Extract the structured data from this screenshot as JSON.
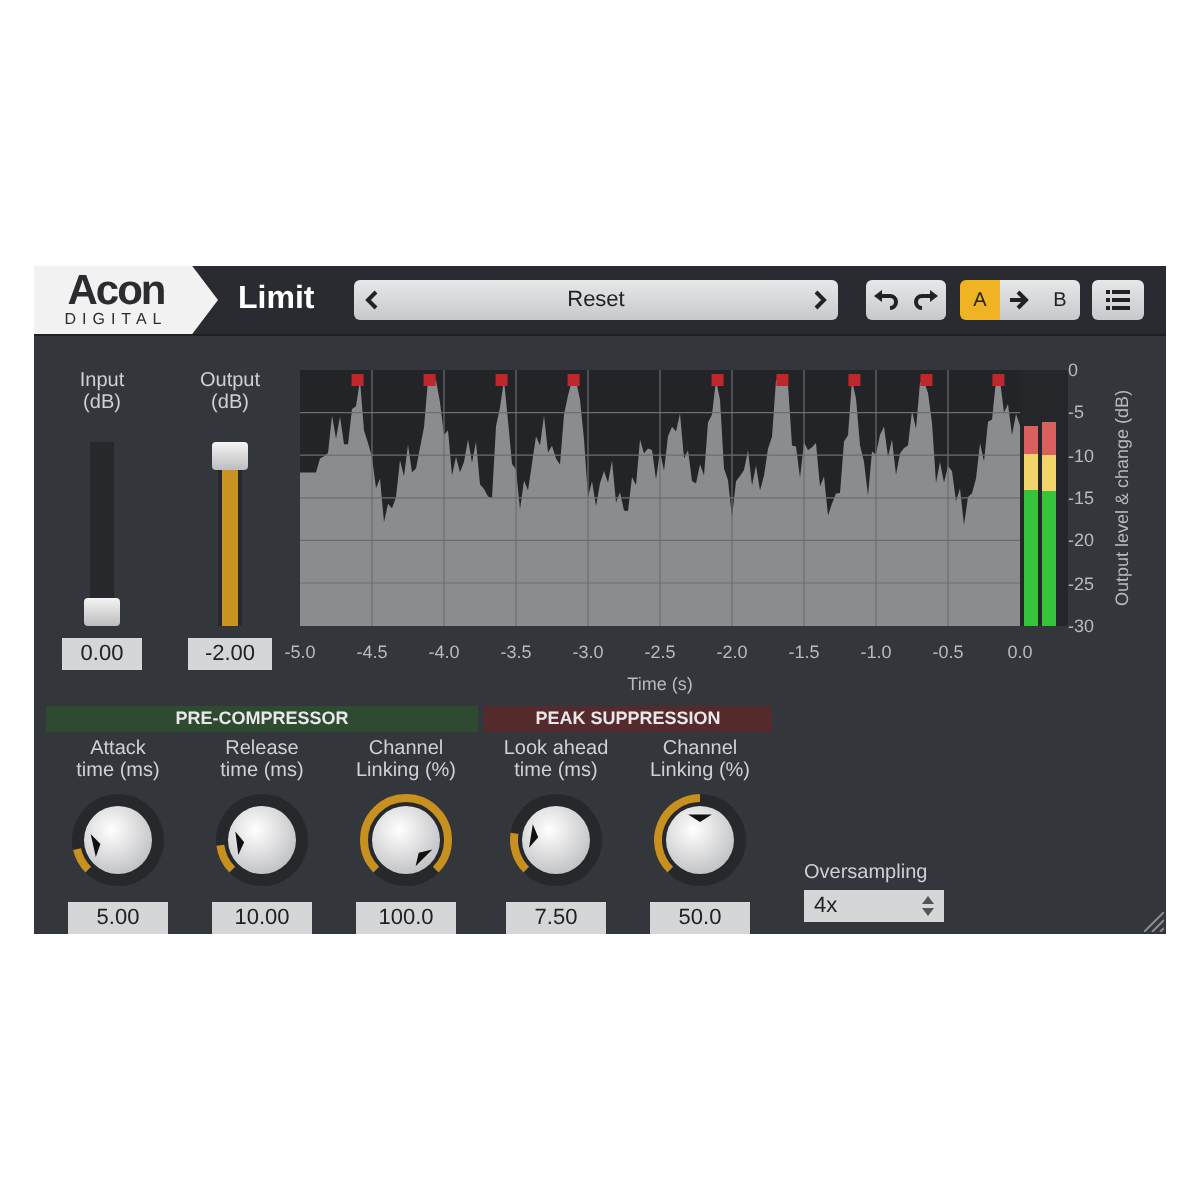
{
  "header": {
    "logo": {
      "wordmark": "Acon",
      "subtitle": "DIGITAL"
    },
    "title": "Limit",
    "preset": "Reset",
    "ab": [
      {
        "label": "A",
        "selected": true
      },
      {
        "label": "B",
        "selected": false
      }
    ]
  },
  "faders": [
    {
      "label": "Input\n(dB)",
      "level": 0.0,
      "value": "0.00"
    },
    {
      "label": "Output\n(dB)",
      "level": 0.92,
      "value": "-2.00"
    }
  ],
  "display": {
    "x_ticks": [
      "-5.0",
      "-4.5",
      "-4.0",
      "-3.5",
      "-3.0",
      "-2.5",
      "-2.0",
      "-1.5",
      "-1.0",
      "-0.5",
      "0.0"
    ],
    "x_title": "Time (s)",
    "y_ticks": [
      "0",
      "-5",
      "-10",
      "-15",
      "-20",
      "-25",
      "-30"
    ],
    "y_title": "Output level & change (dB)",
    "meters": [
      {
        "level": 0.78
      },
      {
        "level": 0.8
      }
    ]
  },
  "sections": [
    {
      "title": "PRE-COMPRESSOR",
      "color": "#2e4a30",
      "knobs": [
        {
          "label": "Attack\ntime (ms)",
          "value": "5.00"
        },
        {
          "label": "Release\ntime (ms)",
          "value": "10.00"
        },
        {
          "label": "Channel\nLinking (%)",
          "value": "100.0"
        }
      ]
    },
    {
      "title": "PEAK SUPPRESSION",
      "color": "#552a2c",
      "knobs": [
        {
          "label": "Look ahead\ntime (ms)",
          "value": "7.50"
        },
        {
          "label": "Channel\nLinking (%)",
          "value": "50.0"
        }
      ]
    }
  ],
  "oversampling": {
    "label": "Oversampling",
    "value": "4x"
  }
}
